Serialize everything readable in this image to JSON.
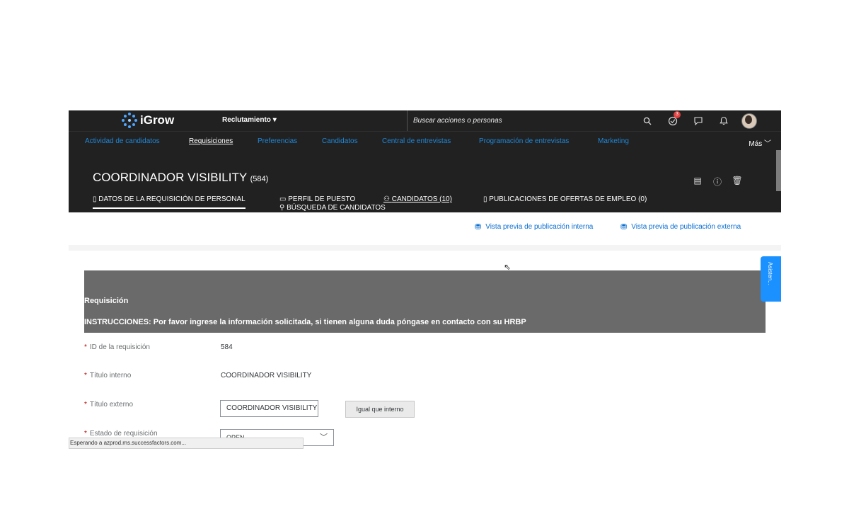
{
  "app": {
    "logo_text": "iGrow",
    "module": "Reclutamiento",
    "search_placeholder": "Buscar acciones o personas",
    "notifications_badge": "3",
    "icons": [
      "search-icon",
      "todo-check-icon",
      "feedback-icon",
      "bell-icon",
      "user-avatar"
    ]
  },
  "nav": {
    "items": [
      {
        "label": "Actividad de candidatos"
      },
      {
        "label": "Requisiciones"
      },
      {
        "label": "Preferencias"
      },
      {
        "label": "Candidatos"
      },
      {
        "label": "Central de entrevistas"
      },
      {
        "label": "Programación de entrevistas"
      },
      {
        "label": "Marketing"
      }
    ],
    "more": "Más",
    "active": "Requisiciones"
  },
  "header": {
    "title": "COORDINADOR VISIBILITY",
    "count": "(584)",
    "tabs": [
      {
        "label": "DATOS DE LA REQUISICIÓN DE PERSONAL"
      },
      {
        "label": "PERFIL DE PUESTO"
      },
      {
        "label": "CANDIDATOS (10)"
      },
      {
        "label": "PUBLICACIONES DE OFERTAS DE EMPLEO (0)"
      },
      {
        "label": "BÚSQUEDA DE CANDIDATOS"
      }
    ]
  },
  "preview": {
    "internal": "Vista previa de publicación interna",
    "external": "Vista previa de publicación externa"
  },
  "section": {
    "title": "Requisición",
    "instructions": "INSTRUCCIONES: Por favor ingrese la información solicitada, si tienen alguna duda póngase en contacto con su HRBP"
  },
  "assistant": "Asisten...",
  "form": {
    "req_id_label": "ID de la requisición",
    "req_id_value": "584",
    "internal_title_label": "Título interno",
    "internal_title_value": "COORDINADOR VISIBILITY",
    "external_title_label": "Título externo",
    "external_title_value": "COORDINADOR VISIBILITY",
    "same_as_internal": "Igual que interno",
    "status_label": "Estado de requisición",
    "status_value": "OPEN",
    "required_mark": "*"
  },
  "statusbar": "Esperando a azprod.ms.successfactors.com..."
}
